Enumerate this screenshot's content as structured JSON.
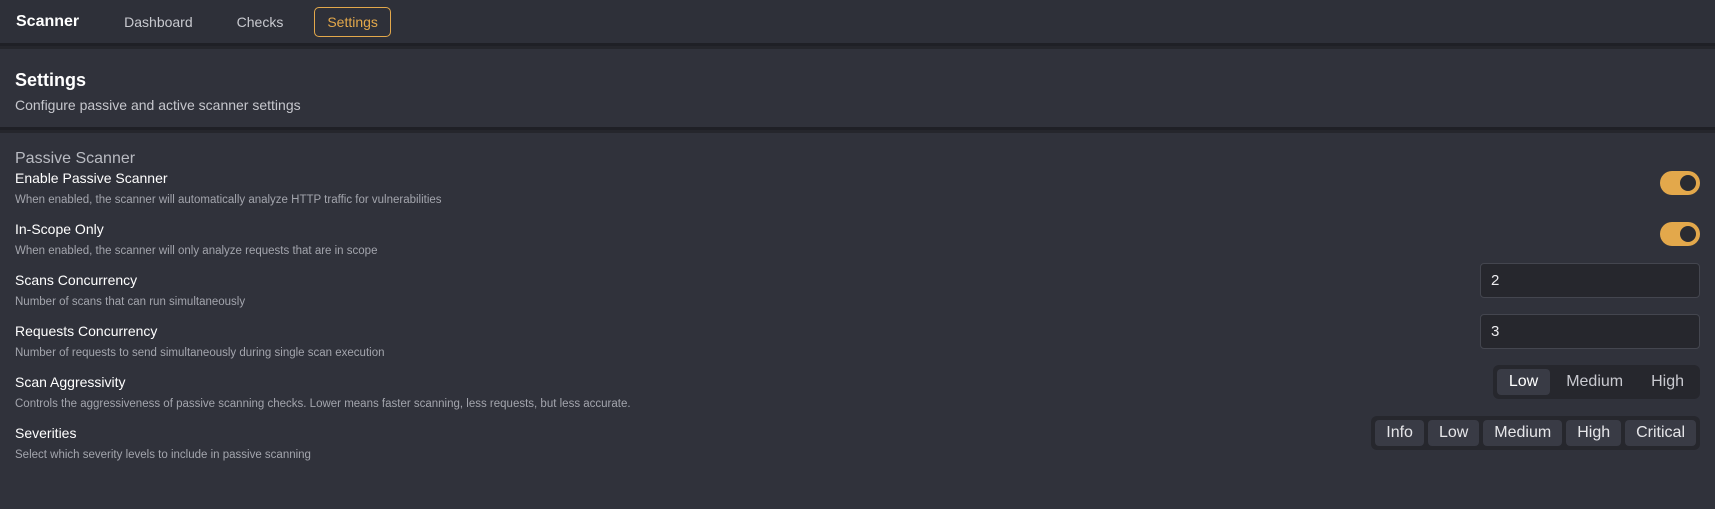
{
  "app": {
    "brand": "Scanner"
  },
  "nav": [
    {
      "label": "Dashboard"
    },
    {
      "label": "Checks"
    },
    {
      "label": "Settings",
      "active": true
    }
  ],
  "header": {
    "title": "Settings",
    "subtitle": "Configure passive and active scanner settings"
  },
  "passive": {
    "title": "Passive Scanner",
    "enable": {
      "label": "Enable Passive Scanner",
      "desc": "When enabled, the scanner will automatically analyze HTTP traffic for vulnerabilities",
      "value": true
    },
    "in_scope": {
      "label": "In-Scope Only",
      "desc": "When enabled, the scanner will only analyze requests that are in scope",
      "value": true
    },
    "scans_concurrency": {
      "label": "Scans Concurrency",
      "desc": "Number of scans that can run simultaneously",
      "value": "2"
    },
    "requests_concurrency": {
      "label": "Requests Concurrency",
      "desc": "Number of requests to send simultaneously during single scan execution",
      "value": "3"
    },
    "aggressivity": {
      "label": "Scan Aggressivity",
      "desc": "Controls the aggressiveness of passive scanning checks. Lower means faster scanning, less requests, but less accurate.",
      "options": [
        "Low",
        "Medium",
        "High"
      ],
      "selected": "Low"
    },
    "severities": {
      "label": "Severities",
      "desc": "Select which severity levels to include in passive scanning",
      "options": [
        "Info",
        "Low",
        "Medium",
        "High",
        "Critical"
      ]
    }
  },
  "colors": {
    "accent": "#e3a84b",
    "background": "#30323b"
  }
}
